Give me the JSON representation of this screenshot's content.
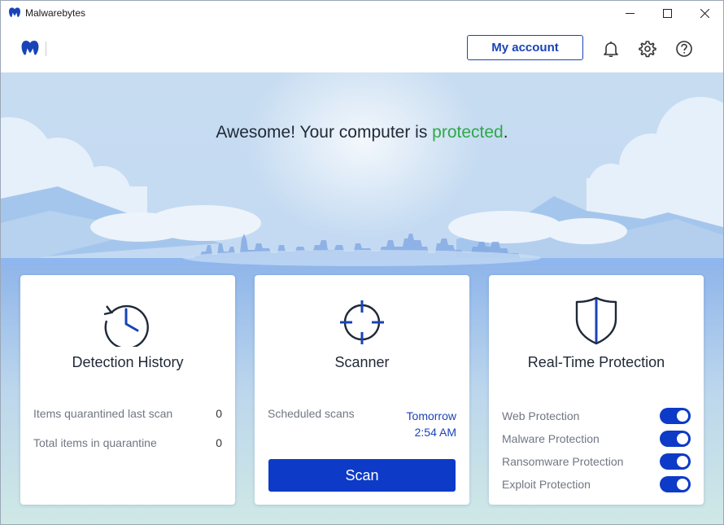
{
  "window": {
    "title": "Malwarebytes"
  },
  "header": {
    "account_label": "My account",
    "icons": [
      "bell-icon",
      "gear-icon",
      "help-icon"
    ]
  },
  "hero": {
    "headline_prefix": "Awesome! Your computer is ",
    "headline_status": "protected",
    "headline_suffix": "."
  },
  "cards": {
    "detection": {
      "title": "Detection History",
      "rows": [
        {
          "label": "Items quarantined last scan",
          "value": "0"
        },
        {
          "label": "Total items in quarantine",
          "value": "0"
        }
      ]
    },
    "scanner": {
      "title": "Scanner",
      "scheduled_label": "Scheduled scans",
      "scheduled_day": "Tomorrow",
      "scheduled_time": "2:54 AM",
      "scan_label": "Scan"
    },
    "realtime": {
      "title": "Real-Time Protection",
      "items": [
        {
          "label": "Web Protection",
          "enabled": true
        },
        {
          "label": "Malware Protection",
          "enabled": true
        },
        {
          "label": "Ransomware Protection",
          "enabled": true
        },
        {
          "label": "Exploit Protection",
          "enabled": true
        }
      ]
    }
  },
  "colors": {
    "accent": "#0d3ac7",
    "protected": "#2ea84a"
  }
}
